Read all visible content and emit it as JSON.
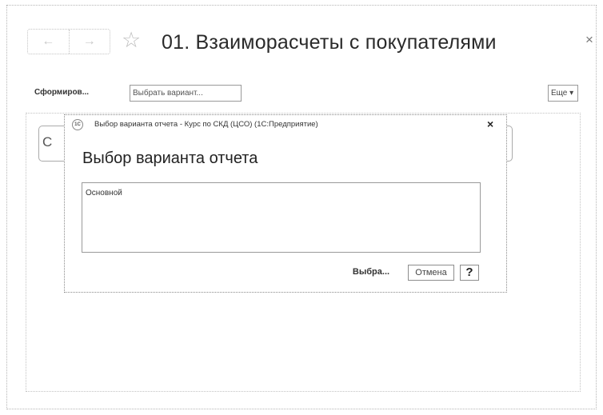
{
  "header": {
    "back_icon": "←",
    "forward_icon": "→",
    "favorite_icon": "☆",
    "title": "01. Взаиморасчеты с покупателями",
    "close_icon": "×"
  },
  "toolbar": {
    "generate_label": "Сформиров...",
    "select_variant_label": "Выбрать вариант...",
    "more_label": "Еще ▾"
  },
  "background_field": {
    "visible_char": "С"
  },
  "dialog": {
    "app_icon_text": "1С",
    "caption": "Выбор варианта отчета - Курс по СКД (ЦСО)  (1С:Предприятие)",
    "close_icon": "×",
    "heading": "Выбор варианта отчета",
    "variants": [
      "Основной"
    ],
    "select_label": "Выбра...",
    "cancel_label": "Отмена",
    "help_label": "?"
  }
}
